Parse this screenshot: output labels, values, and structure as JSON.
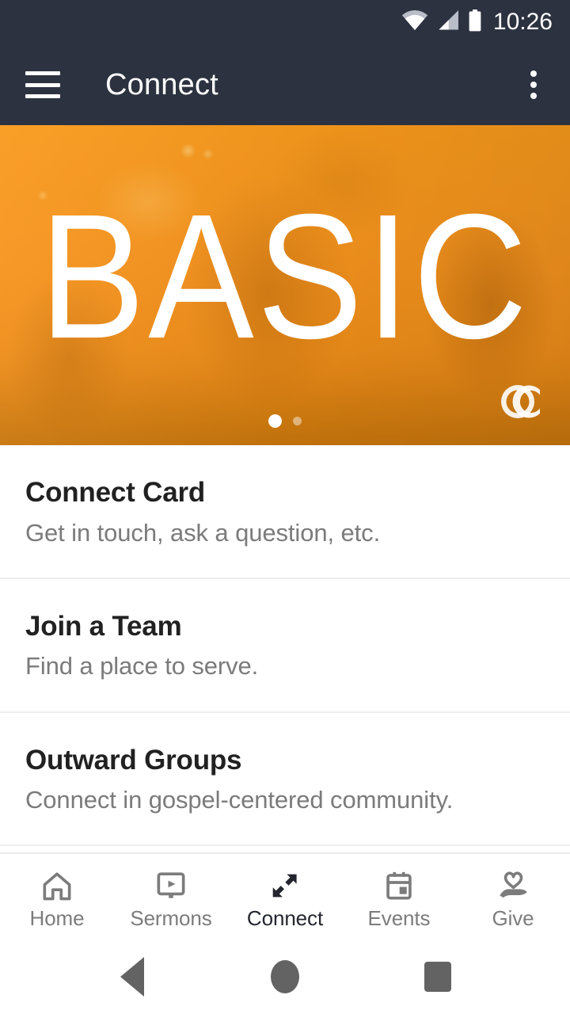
{
  "status_bar": {
    "time": "10:26",
    "icons": [
      "wifi-icon",
      "cell-signal-icon",
      "battery-icon"
    ]
  },
  "app_bar": {
    "menu_icon": "hamburger-menu-icon",
    "title": "Connect",
    "overflow_icon": "overflow-menu-icon"
  },
  "hero": {
    "word": "BASIC",
    "logo": "oc-monogram-logo",
    "carousel": {
      "total": 2,
      "active_index": 0
    }
  },
  "list": {
    "items": [
      {
        "title": "Connect Card",
        "subtitle": "Get in touch, ask a question, etc."
      },
      {
        "title": "Join a Team",
        "subtitle": "Find a place to serve."
      },
      {
        "title": "Outward Groups",
        "subtitle": "Connect in gospel-centered community."
      }
    ]
  },
  "tab_bar": {
    "active_index": 2,
    "tabs": [
      {
        "label": "Home",
        "icon": "home-icon"
      },
      {
        "label": "Sermons",
        "icon": "video-monitor-icon"
      },
      {
        "label": "Connect",
        "icon": "converging-arrows-icon"
      },
      {
        "label": "Events",
        "icon": "calendar-icon"
      },
      {
        "label": "Give",
        "icon": "hand-heart-icon"
      }
    ]
  },
  "android_nav": {
    "back": "back-triangle-icon",
    "home": "home-circle-icon",
    "recents": "recents-square-icon"
  },
  "colors": {
    "app_bar": "#2d3240",
    "hero_orange": "#f7941e",
    "title_text": "#212121",
    "subtitle_text": "#7b7b7b",
    "tab_inactive": "#7c7c7c",
    "tab_active": "#23262e"
  }
}
